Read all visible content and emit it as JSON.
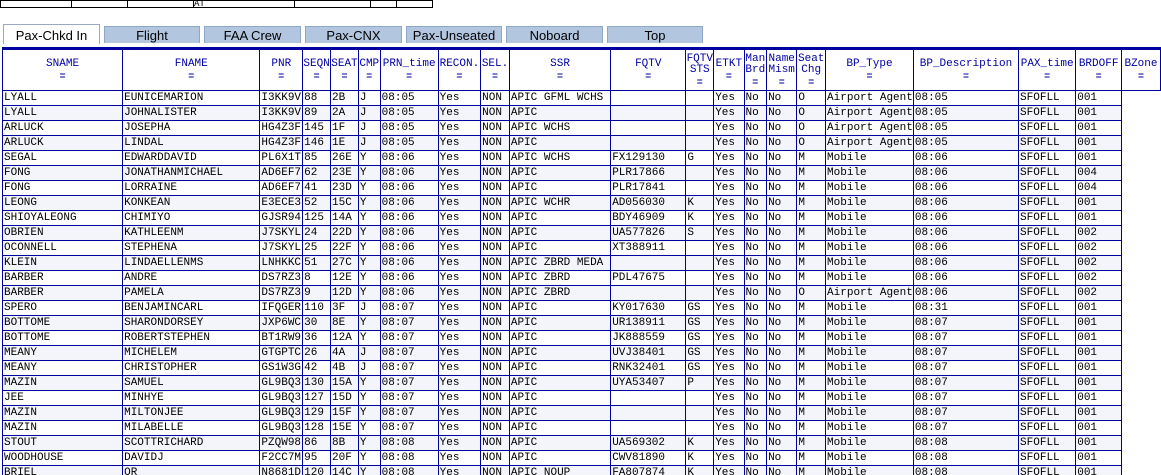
{
  "top_strip": {
    "fragment": "AT"
  },
  "tabs": [
    {
      "label": "Pax-Chkd In",
      "active": true
    },
    {
      "label": "Flight",
      "active": false
    },
    {
      "label": "FAA Crew",
      "active": false
    },
    {
      "label": "Pax-CNX",
      "active": false
    },
    {
      "label": "Pax-Unseated",
      "active": false
    },
    {
      "label": "Noboard",
      "active": false
    },
    {
      "label": "Top",
      "active": false
    }
  ],
  "columns": [
    "SNAME",
    "FNAME",
    "PNR",
    "SEQN",
    "SEAT",
    "CMP",
    "PRN_time",
    "RECON.",
    "SEL.",
    "SSR",
    "FQTV",
    "FQTV STS",
    "ETKT",
    "Man Brd",
    "Name Mism",
    "Seat Chg",
    "BP_Type",
    "BP_Description",
    "PAX_time",
    "BRDOFF",
    "BZone"
  ],
  "sort_icon": "sort-icon",
  "rows": [
    [
      "LYALL",
      "EUNICEMARION",
      "I3KK9V",
      "88",
      "2B",
      "J",
      "08:05",
      "Yes",
      "NON",
      "APIC GFML WCHS",
      "",
      "",
      "Yes",
      "No",
      "No",
      "O",
      "Airport Agent",
      "08:05",
      "SFOFLL",
      "001"
    ],
    [
      "LYALL",
      "JOHNALISTER",
      "I3KK9V",
      "89",
      "2A",
      "J",
      "08:05",
      "Yes",
      "NON",
      "APIC",
      "",
      "",
      "Yes",
      "No",
      "No",
      "O",
      "Airport Agent",
      "08:05",
      "SFOFLL",
      "001"
    ],
    [
      "ARLUCK",
      "JOSEPHA",
      "HG4Z3F",
      "145",
      "1F",
      "J",
      "08:05",
      "Yes",
      "NON",
      "APIC WCHS",
      "",
      "",
      "Yes",
      "No",
      "No",
      "O",
      "Airport Agent",
      "08:05",
      "SFOFLL",
      "001"
    ],
    [
      "ARLUCK",
      "LINDAL",
      "HG4Z3F",
      "146",
      "1E",
      "J",
      "08:05",
      "Yes",
      "NON",
      "APIC",
      "",
      "",
      "Yes",
      "No",
      "No",
      "O",
      "Airport Agent",
      "08:05",
      "SFOFLL",
      "001"
    ],
    [
      "SEGAL",
      "EDWARDDAVID",
      "PL6X1T",
      "85",
      "26E",
      "Y",
      "08:06",
      "Yes",
      "NON",
      "APIC WCHS",
      "FX129130",
      "G",
      "Yes",
      "No",
      "No",
      "M",
      "Mobile",
      "08:06",
      "SFOFLL",
      "001"
    ],
    [
      "FONG",
      "JONATHANMICHAEL",
      "AD6EF7",
      "62",
      "23E",
      "Y",
      "08:06",
      "Yes",
      "NON",
      "APIC",
      "PLR17866",
      "",
      "Yes",
      "No",
      "No",
      "M",
      "Mobile",
      "08:06",
      "SFOFLL",
      "004"
    ],
    [
      "FONG",
      "LORRAINE",
      "AD6EF7",
      "41",
      "23D",
      "Y",
      "08:06",
      "Yes",
      "NON",
      "APIC",
      "PLR17841",
      "",
      "Yes",
      "No",
      "No",
      "M",
      "Mobile",
      "08:06",
      "SFOFLL",
      "004"
    ],
    [
      "LEONG",
      "KONKEAN",
      "E3ECE3",
      "52",
      "15C",
      "Y",
      "08:06",
      "Yes",
      "NON",
      "APIC WCHR",
      "AD056030",
      "K",
      "Yes",
      "No",
      "No",
      "M",
      "Mobile",
      "08:06",
      "SFOFLL",
      "001"
    ],
    [
      "SHIOYALEONG",
      "CHIMIYO",
      "GJSR94",
      "125",
      "14A",
      "Y",
      "08:06",
      "Yes",
      "NON",
      "APIC",
      "BDY46909",
      "K",
      "Yes",
      "No",
      "No",
      "M",
      "Mobile",
      "08:06",
      "SFOFLL",
      "001"
    ],
    [
      "OBRIEN",
      "KATHLEENM",
      "J7SKYL",
      "24",
      "22D",
      "Y",
      "08:06",
      "Yes",
      "NON",
      "APIC",
      "UA577826",
      "S",
      "Yes",
      "No",
      "No",
      "M",
      "Mobile",
      "08:06",
      "SFOFLL",
      "002"
    ],
    [
      "OCONNELL",
      "STEPHENA",
      "J7SKYL",
      "25",
      "22F",
      "Y",
      "08:06",
      "Yes",
      "NON",
      "APIC",
      "XT388911",
      "",
      "Yes",
      "No",
      "No",
      "M",
      "Mobile",
      "08:06",
      "SFOFLL",
      "002"
    ],
    [
      "KLEIN",
      "LINDAELLENMS",
      "LNHKKC",
      "51",
      "27C",
      "Y",
      "08:06",
      "Yes",
      "NON",
      "APIC ZBRD MEDA",
      "",
      "",
      "Yes",
      "No",
      "No",
      "M",
      "Mobile",
      "08:06",
      "SFOFLL",
      "002"
    ],
    [
      "BARBER",
      "ANDRE",
      "DS7RZ3",
      "8",
      "12E",
      "Y",
      "08:06",
      "Yes",
      "NON",
      "APIC ZBRD",
      "PDL47675",
      "",
      "Yes",
      "No",
      "No",
      "M",
      "Mobile",
      "08:06",
      "SFOFLL",
      "002"
    ],
    [
      "BARBER",
      "PAMELA",
      "DS7RZ3",
      "9",
      "12D",
      "Y",
      "08:06",
      "Yes",
      "NON",
      "APIC ZBRD",
      "",
      "",
      "Yes",
      "No",
      "No",
      "O",
      "Airport Agent",
      "08:06",
      "SFOFLL",
      "002"
    ],
    [
      "SPERO",
      "BENJAMINCARL",
      "IFQGER",
      "110",
      "3F",
      "J",
      "08:07",
      "Yes",
      "NON",
      "APIC",
      "KY017630",
      "GS",
      "Yes",
      "No",
      "No",
      "M",
      "Mobile",
      "08:31",
      "SFOFLL",
      "001"
    ],
    [
      "BOTTOME",
      "SHARONDORSEY",
      "JXP6WC",
      "30",
      "8E",
      "Y",
      "08:07",
      "Yes",
      "NON",
      "APIC",
      "UR138911",
      "GS",
      "Yes",
      "No",
      "No",
      "M",
      "Mobile",
      "08:07",
      "SFOFLL",
      "001"
    ],
    [
      "BOTTOME",
      "ROBERTSTEPHEN",
      "BT1RW9",
      "36",
      "12A",
      "Y",
      "08:07",
      "Yes",
      "NON",
      "APIC",
      "JK888559",
      "GS",
      "Yes",
      "No",
      "No",
      "M",
      "Mobile",
      "08:07",
      "SFOFLL",
      "001"
    ],
    [
      "MEANY",
      "MICHELEM",
      "GTGPTC",
      "26",
      "4A",
      "J",
      "08:07",
      "Yes",
      "NON",
      "APIC",
      "UVJ38401",
      "GS",
      "Yes",
      "No",
      "No",
      "M",
      "Mobile",
      "08:07",
      "SFOFLL",
      "001"
    ],
    [
      "MEANY",
      "CHRISTOPHER",
      "GS1W3G",
      "42",
      "4B",
      "J",
      "08:07",
      "Yes",
      "NON",
      "APIC",
      "RNK32401",
      "GS",
      "Yes",
      "No",
      "No",
      "M",
      "Mobile",
      "08:07",
      "SFOFLL",
      "001"
    ],
    [
      "MAZIN",
      "SAMUEL",
      "GL9BQ3",
      "130",
      "15A",
      "Y",
      "08:07",
      "Yes",
      "NON",
      "APIC",
      "UYA53407",
      "P",
      "Yes",
      "No",
      "No",
      "M",
      "Mobile",
      "08:07",
      "SFOFLL",
      "001"
    ],
    [
      "JEE",
      "MINHYE",
      "GL9BQ3",
      "127",
      "15D",
      "Y",
      "08:07",
      "Yes",
      "NON",
      "APIC",
      "",
      "",
      "Yes",
      "No",
      "No",
      "M",
      "Mobile",
      "08:07",
      "SFOFLL",
      "001"
    ],
    [
      "MAZIN",
      "MILTONJEE",
      "GL9BQ3",
      "129",
      "15F",
      "Y",
      "08:07",
      "Yes",
      "NON",
      "APIC",
      "",
      "",
      "Yes",
      "No",
      "No",
      "M",
      "Mobile",
      "08:07",
      "SFOFLL",
      "001"
    ],
    [
      "MAZIN",
      "MILABELLE",
      "GL9BQ3",
      "128",
      "15E",
      "Y",
      "08:07",
      "Yes",
      "NON",
      "APIC",
      "",
      "",
      "Yes",
      "No",
      "No",
      "M",
      "Mobile",
      "08:07",
      "SFOFLL",
      "001"
    ],
    [
      "STOUT",
      "SCOTTRICHARD",
      "PZQW98",
      "86",
      "8B",
      "Y",
      "08:08",
      "Yes",
      "NON",
      "APIC",
      "UA569302",
      "K",
      "Yes",
      "No",
      "No",
      "M",
      "Mobile",
      "08:08",
      "SFOFLL",
      "001"
    ],
    [
      "WOODHOUSE",
      "DAVIDJ",
      "F2CC7M",
      "95",
      "20F",
      "Y",
      "08:08",
      "Yes",
      "NON",
      "APIC",
      "CWV81890",
      "K",
      "Yes",
      "No",
      "No",
      "M",
      "Mobile",
      "08:08",
      "SFOFLL",
      "001"
    ],
    [
      "BRIEL",
      "OR",
      "N8681D",
      "120",
      "14C",
      "Y",
      "08:08",
      "Yes",
      "NON",
      "APIC NOUP",
      "FA807874",
      "K",
      "Yes",
      "No",
      "No",
      "M",
      "Mobile",
      "08:08",
      "SFOFLL",
      "001"
    ]
  ]
}
